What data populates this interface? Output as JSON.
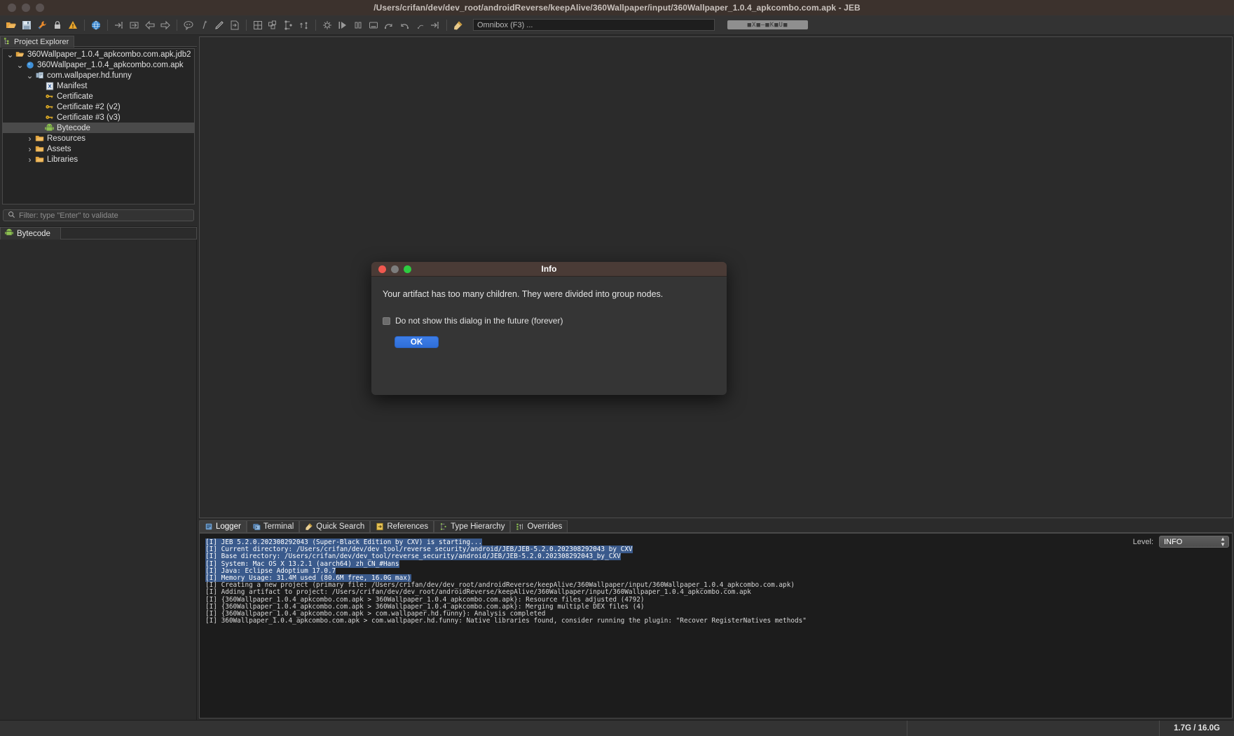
{
  "window": {
    "title": "/Users/crifan/dev/dev_root/androidReverse/keepAlive/360Wallpaper/input/360Wallpaper_1.0.4_apkcombo.com.apk - JEB"
  },
  "toolbar": {
    "icons": [
      "open-folder-icon",
      "save-icon",
      "wrench-icon",
      "lock-icon",
      "warning-icon",
      "globe-icon",
      "navigate-into-icon",
      "navigate-out-icon",
      "back-arrow-icon",
      "forward-arrow-icon",
      "comment-icon",
      "wildcard-icon",
      "pencil-icon",
      "export-icon",
      "grid-icon",
      "graph-icon",
      "hierarchy-icon",
      "sort-icon",
      "debug-icon",
      "run-icon",
      "pause-icon",
      "stop-icon",
      "step-over-icon",
      "step-return-icon",
      "step-into-small-icon",
      "goto-icon",
      "highlight-icon"
    ],
    "omnibox_placeholder": "Omnibox (F3) ...",
    "progress_label": "■X■–■K■U■"
  },
  "sidebar": {
    "tab_label": "Project Explorer",
    "tab_icon": "project-explorer-icon",
    "tree": [
      {
        "label": "360Wallpaper_1.0.4_apkcombo.com.apk.jdb2",
        "indent": 0,
        "twist": "down",
        "icon": "folder-open-icon",
        "selected": false
      },
      {
        "label": "360Wallpaper_1.0.4_apkcombo.com.apk",
        "indent": 1,
        "twist": "down",
        "icon": "blue-circle-icon",
        "selected": false
      },
      {
        "label": "com.wallpaper.hd.funny",
        "indent": 2,
        "twist": "down",
        "icon": "package-icon",
        "selected": false
      },
      {
        "label": "Manifest",
        "indent": 3,
        "twist": "none",
        "icon": "xml-icon",
        "selected": false
      },
      {
        "label": "Certificate",
        "indent": 3,
        "twist": "none",
        "icon": "key-icon",
        "selected": false
      },
      {
        "label": "Certificate #2 (v2)",
        "indent": 3,
        "twist": "none",
        "icon": "key-icon",
        "selected": false
      },
      {
        "label": "Certificate #3 (v3)",
        "indent": 3,
        "twist": "none",
        "icon": "key-icon",
        "selected": false
      },
      {
        "label": "Bytecode",
        "indent": 3,
        "twist": "none",
        "icon": "android-icon",
        "selected": true
      },
      {
        "label": "Resources",
        "indent": 2,
        "twist": "right",
        "icon": "folder-icon",
        "selected": false
      },
      {
        "label": "Assets",
        "indent": 2,
        "twist": "right",
        "icon": "folder-icon",
        "selected": false
      },
      {
        "label": "Libraries",
        "indent": 2,
        "twist": "right",
        "icon": "folder-icon",
        "selected": false
      }
    ],
    "filter_placeholder": "Filter: type \"Enter\" to validate",
    "bytecode_tab_label": "Bytecode",
    "bytecode_tab_icon": "android-icon"
  },
  "bottom_panel": {
    "tabs": [
      {
        "label": "Logger",
        "icon": "logger-icon",
        "active": true
      },
      {
        "label": "Terminal",
        "icon": "terminal-icon",
        "active": false
      },
      {
        "label": "Quick Search",
        "icon": "quick-search-icon",
        "active": false
      },
      {
        "label": "References",
        "icon": "references-icon",
        "active": false
      },
      {
        "label": "Type Hierarchy",
        "icon": "type-hierarchy-icon",
        "active": false
      },
      {
        "label": "Overrides",
        "icon": "overrides-icon",
        "active": false
      }
    ],
    "level_label": "Level:",
    "level_value": "INFO",
    "log_lines": [
      {
        "text": "[I] JEB 5.2.0.202308292043 (Super-Black Edition by CXV) is starting...",
        "highlighted": true
      },
      {
        "text": "[I] Current directory: /Users/crifan/dev/dev_tool/reverse_security/android/JEB/JEB-5.2.0.202308292043_by_CXV",
        "highlighted": true
      },
      {
        "text": "[I] Base directory: /Users/crifan/dev/dev_tool/reverse_security/android/JEB/JEB-5.2.0.202308292043_by_CXV",
        "highlighted": true
      },
      {
        "text": "[I] System: Mac OS X 13.2.1 (aarch64) zh_CN_#Hans",
        "highlighted": true
      },
      {
        "text": "[I] Java: Eclipse Adoptium 17.0.7",
        "highlighted": true
      },
      {
        "text": "[I] Memory Usage: 31.4M used (80.6M free, 16.0G max)",
        "highlighted": true
      },
      {
        "text": "[I] Creating a new project (primary file: /Users/crifan/dev/dev_root/androidReverse/keepAlive/360Wallpaper/input/360Wallpaper_1.0.4_apkcombo.com.apk)",
        "highlighted": false
      },
      {
        "text": "[I] Adding artifact to project: /Users/crifan/dev/dev_root/androidReverse/keepAlive/360Wallpaper/input/360Wallpaper_1.0.4_apkcombo.com.apk",
        "highlighted": false
      },
      {
        "text": "[I] {360Wallpaper_1.0.4_apkcombo.com.apk > 360Wallpaper_1.0.4_apkcombo.com.apk}: Resource files adjusted (4792)",
        "highlighted": false
      },
      {
        "text": "[I] {360Wallpaper_1.0.4_apkcombo.com.apk > 360Wallpaper_1.0.4_apkcombo.com.apk}: Merging multiple DEX files (4)",
        "highlighted": false
      },
      {
        "text": "[I] {360Wallpaper_1.0.4_apkcombo.com.apk > com.wallpaper.hd.funny}: Analysis completed",
        "highlighted": false
      },
      {
        "text": "[I] 360Wallpaper_1.0.4_apkcombo.com.apk > com.wallpaper.hd.funny: Native libraries found, consider running the plugin: \"Recover RegisterNatives methods\"",
        "highlighted": false
      }
    ]
  },
  "statusbar": {
    "memory": "1.7G / 16.0G"
  },
  "dialog": {
    "title": "Info",
    "message": "Your artifact has too many children. They were divided into group nodes.",
    "checkbox_label": "Do not show this dialog in the future (forever)",
    "checkbox_checked": false,
    "ok_label": "OK"
  },
  "colors": {
    "accent_blue": "#2f6fd8",
    "log_highlight": "#3a5a8c",
    "titlebar": "#3c322d",
    "dialog_titlebar": "#4a3b36"
  }
}
